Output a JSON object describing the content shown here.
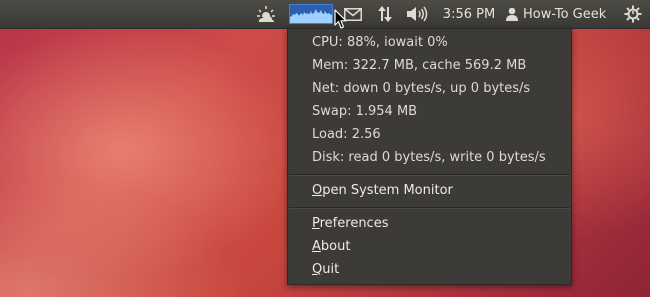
{
  "panel": {
    "time": "3:56 PM",
    "user": "How-To Geek",
    "icons": [
      "weather-icon",
      "cpu-graph-icon",
      "mail-icon",
      "network-icon",
      "volume-icon",
      "user-icon",
      "power-icon"
    ],
    "cpu_color": "#2c5fb2"
  },
  "menu": {
    "stats": [
      "CPU: 88%, iowait 0%",
      "Mem: 322.7 MB, cache 569.2 MB",
      "Net: down 0 bytes/s, up 0 bytes/s",
      "Swap: 1.954 MB",
      "Load: 2.56",
      "Disk: read 0 bytes/s, write 0 bytes/s"
    ],
    "open_monitor": {
      "key": "O",
      "rest": "pen System Monitor"
    },
    "preferences": {
      "key": "P",
      "rest": "references"
    },
    "about": {
      "key": "A",
      "rest": "bout"
    },
    "quit": {
      "key": "Q",
      "rest": "uit"
    }
  }
}
